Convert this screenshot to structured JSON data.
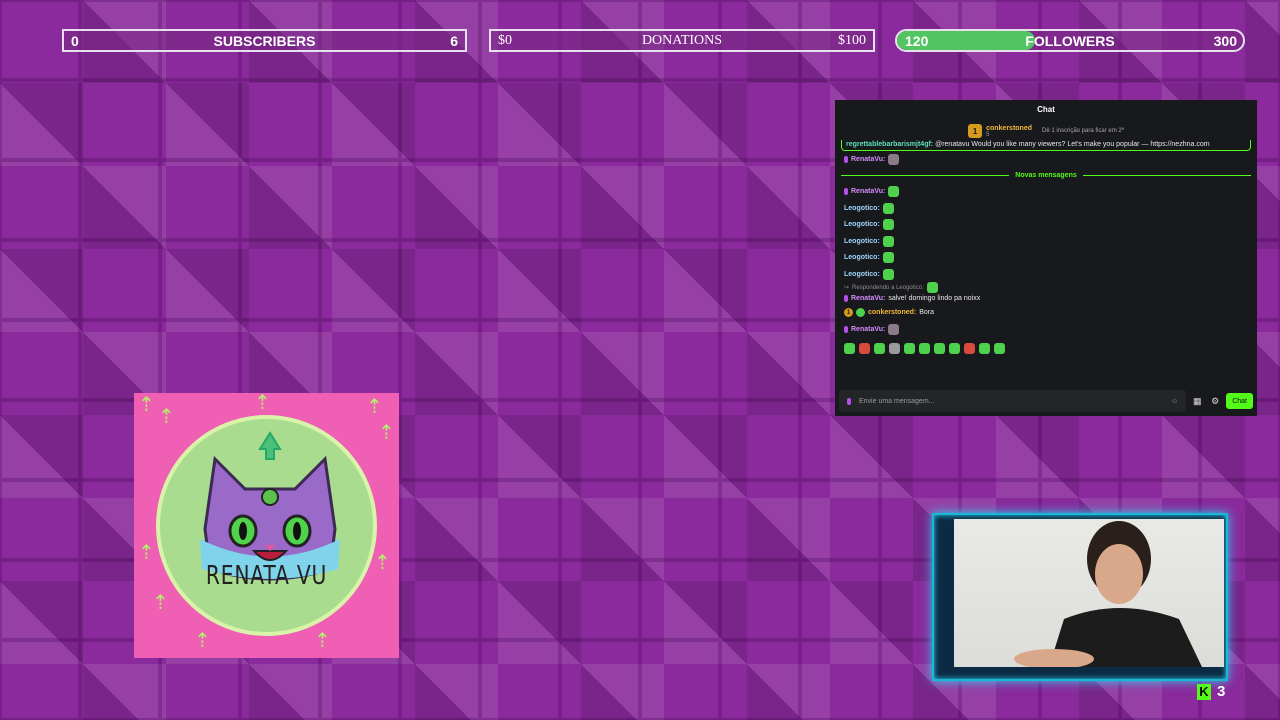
{
  "goals": {
    "subscribers": {
      "current": "0",
      "label": "SUBSCRIBERS",
      "target": "6"
    },
    "donations": {
      "current": "$0",
      "label": "DONATIONS",
      "target": "$100"
    },
    "followers": {
      "current": "120",
      "label": "FOLLOWERS",
      "target": "300",
      "progress": 0.4,
      "fill_color": "#53c462"
    }
  },
  "chat": {
    "title": "Chat",
    "pinned": {
      "badge": "1",
      "name": "conkerstoned",
      "count": "5",
      "note": "Dê 1 inscrição para ficar em 2º"
    },
    "highlight": {
      "user": "regrettablebarbarismjt4gf:",
      "text": "@renatavu Would you like many viewers? Let's make you popular — https://nezhna.com"
    },
    "new_messages_label": "Novas mensagens",
    "messages": [
      {
        "user": "RenataVu:",
        "role": "owner"
      },
      {
        "user": "RenataVu:",
        "role": "owner"
      },
      {
        "user": "Leogotico:",
        "role": "viewer"
      },
      {
        "user": "Leogotico:",
        "role": "viewer"
      },
      {
        "user": "Leogotico:",
        "role": "viewer"
      },
      {
        "user": "Leogotico:",
        "role": "viewer"
      },
      {
        "user": "Leogotico:",
        "role": "viewer"
      }
    ],
    "reply_note": "Respondendo a Leogotico:",
    "reply_msg": {
      "user": "RenataVu:",
      "text": "salve! domingo lindo pa noixx"
    },
    "sub_msg": {
      "badge": "1",
      "user": "conkerstoned:",
      "text": "Bora"
    },
    "last_msg": {
      "user": "RenataVu:"
    },
    "input_placeholder": "Envie uma mensagem...",
    "send_label": "Chat",
    "accent": "#53fc18"
  },
  "logo": {
    "text": "RENATA VU"
  },
  "kick": {
    "icon": "kick-logo-icon",
    "letter": "K",
    "viewers": "3"
  }
}
